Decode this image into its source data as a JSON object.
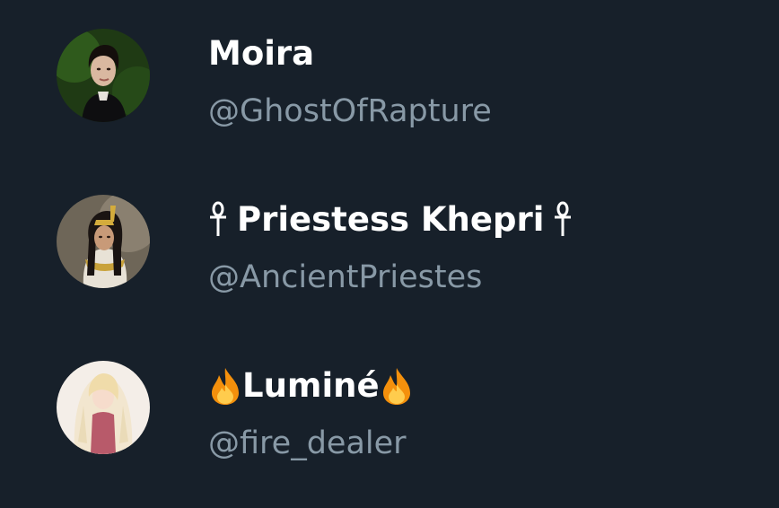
{
  "accounts": [
    {
      "display_name": "Moira",
      "handle": "@GhostOfRapture",
      "avatar_icon": "portrait-woman-dark-hair"
    },
    {
      "display_name": "Priestess Khepri",
      "handle": "@AncientPriestes",
      "avatar_icon": "portrait-egyptian-priestess",
      "name_decoration": "ankh-icon"
    },
    {
      "display_name": "Luminé",
      "handle": "@fire_dealer",
      "avatar_icon": "portrait-anime-blonde",
      "name_decoration": "fire-icon"
    }
  ],
  "colors": {
    "background": "#17202a",
    "name": "#ffffff",
    "handle": "#8899a6"
  }
}
